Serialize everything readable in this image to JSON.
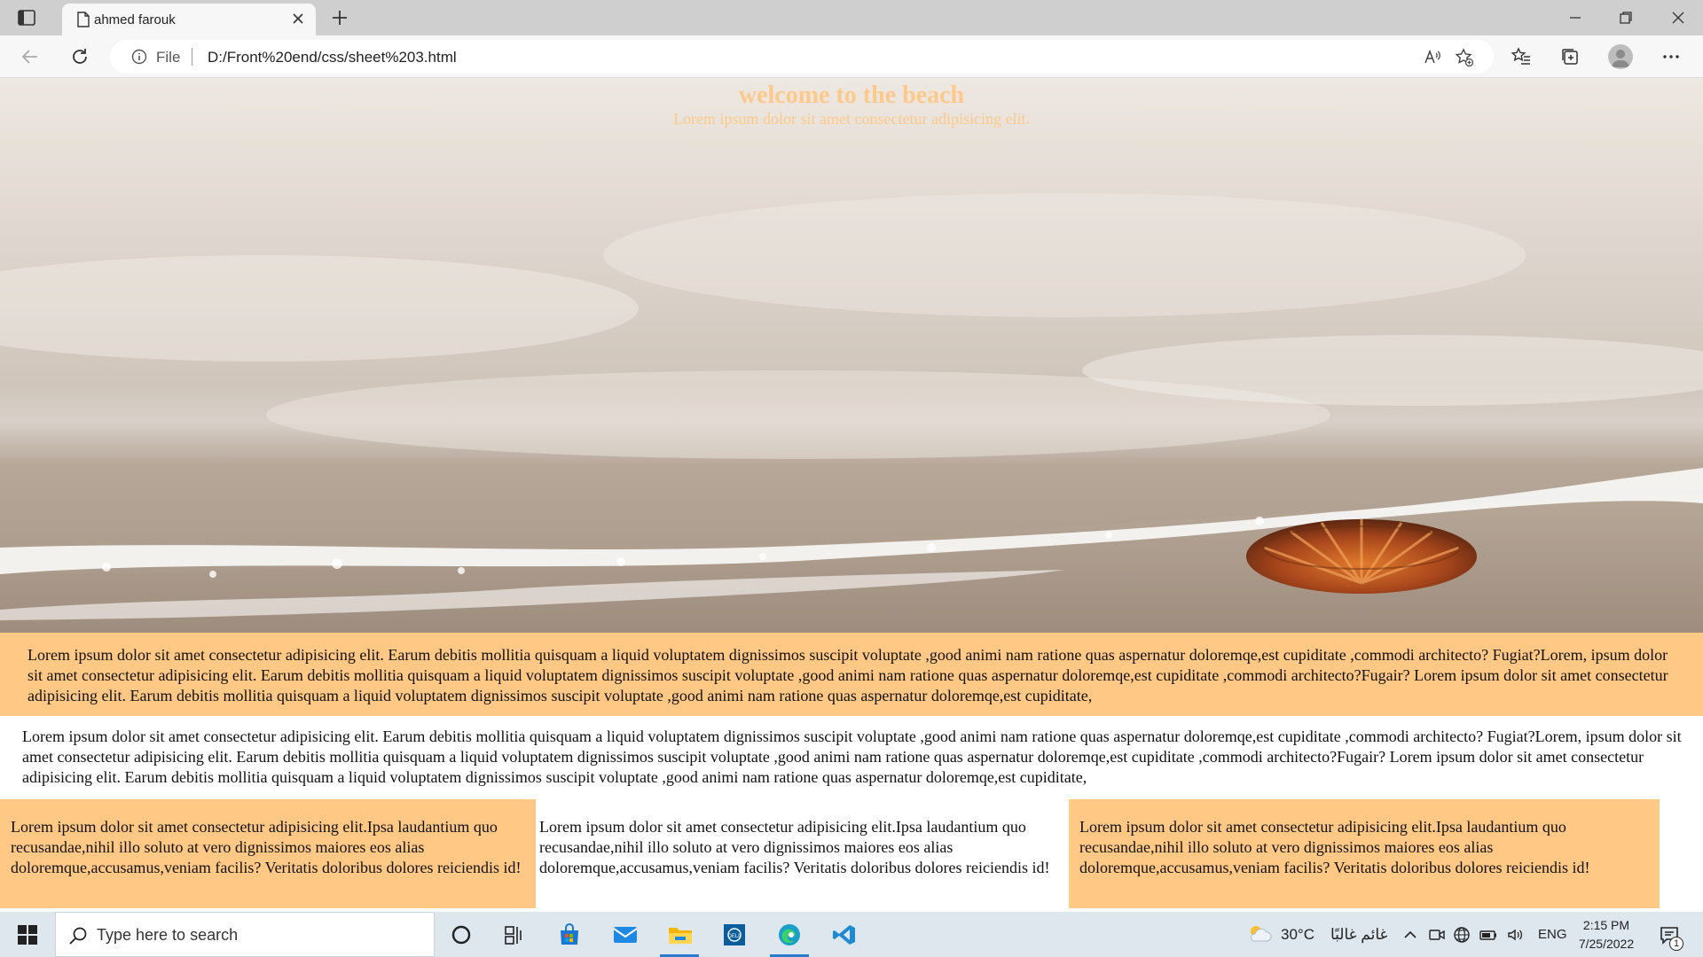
{
  "browser": {
    "tab_title": "ahmed farouk",
    "scheme_label": "File",
    "url": "D:/Front%20end/css/sheet%203.html"
  },
  "page": {
    "hero_title": "welcome to the beach",
    "hero_subtitle": "Lorem ipsum dolor sit amet consectetur adipisicing elit.",
    "paragraph_1": "Lorem ipsum dolor sit amet consectetur adipisicing elit. Earum debitis mollitia quisquam a liquid voluptatem dignissimos suscipit voluptate ,good animi nam ratione quas aspernatur doloremqe,est cupiditate ,commodi architecto? Fugiat?Lorem, ipsum dolor sit amet consectetur adipisicing elit. Earum debitis mollitia quisquam a liquid voluptatem dignissimos suscipit voluptate ,good animi nam ratione quas aspernatur doloremqe,est cupiditate ,commodi architecto?Fugair? Lorem ipsum dolor sit amet consectetur adipisicing elit. Earum debitis mollitia quisquam a liquid voluptatem dignissimos suscipit voluptate ,good animi nam ratione quas aspernatur doloremqe,est cupiditate,",
    "paragraph_2": "Lorem ipsum dolor sit amet consectetur adipisicing elit. Earum debitis mollitia quisquam a liquid voluptatem dignissimos suscipit voluptate ,good animi nam ratione quas aspernatur doloremqe,est cupiditate ,commodi architecto? Fugiat?Lorem, ipsum dolor sit amet consectetur adipisicing elit. Earum debitis mollitia quisquam a liquid voluptatem dignissimos suscipit voluptate ,good animi nam ratione quas aspernatur doloremqe,est cupiditate ,commodi architecto?Fugair? Lorem ipsum dolor sit amet consectetur adipisicing elit. Earum debitis mollitia quisquam a liquid voluptatem dignissimos suscipit voluptate ,good animi nam ratione quas aspernatur doloremqe,est cupiditate,",
    "columns": [
      "Lorem ipsum dolor sit amet consectetur adipisicing elit.Ipsa laudantium quo recusandae,nihil illo soluto at vero dignissimos maiores eos alias doloremque,accusamus,veniam facilis? Veritatis doloribus dolores reiciendis id!",
      "Lorem ipsum dolor sit amet consectetur adipisicing elit.Ipsa laudantium quo recusandae,nihil illo soluto at vero dignissimos maiores eos alias doloremque,accusamus,veniam facilis? Veritatis doloribus dolores reiciendis id!",
      "Lorem ipsum dolor sit amet consectetur adipisicing elit.Ipsa laudantium quo recusandae,nihil illo soluto at vero dignissimos maiores eos alias doloremque,accusamus,veniam facilis? Veritatis doloribus dolores reiciendis id!"
    ],
    "accent_color": "#ffc884"
  },
  "taskbar": {
    "search_placeholder": "Type here to search",
    "weather_temp": "30°C",
    "weather_condition": "غائم غالبًا",
    "language": "ENG",
    "time": "2:15 PM",
    "date": "7/25/2022",
    "notification_count": "1"
  }
}
